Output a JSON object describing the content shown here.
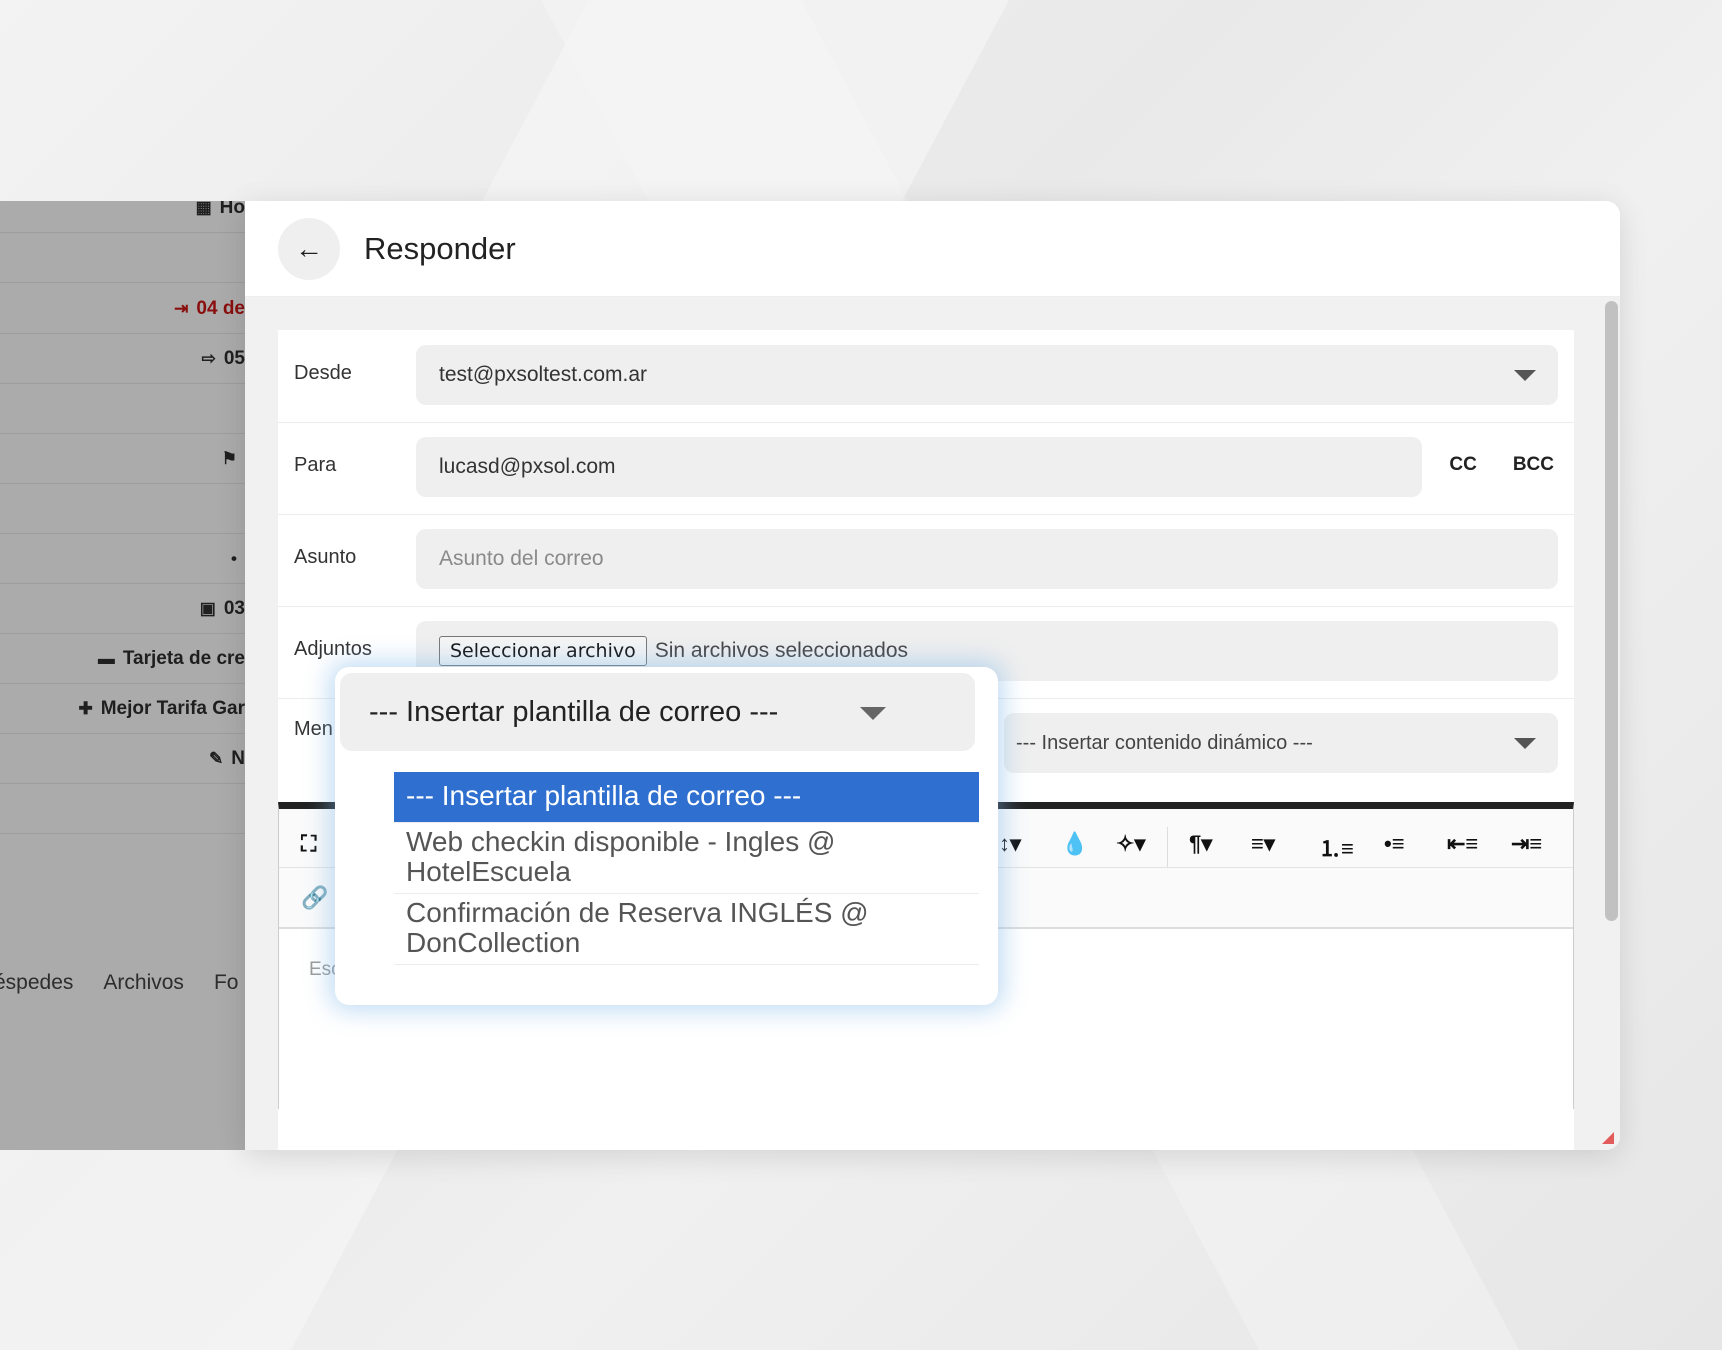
{
  "left_panel": {
    "rows": [
      {
        "icon": "building-icon",
        "glyph": "▦",
        "text": "Ho"
      },
      {
        "icon": "",
        "glyph": "",
        "text": ""
      },
      {
        "icon": "checkin-icon",
        "glyph": "⇥",
        "text": "04 de"
      },
      {
        "icon": "checkout-icon",
        "glyph": "⇨",
        "text": "05"
      },
      {
        "icon": "",
        "glyph": "",
        "text": ""
      },
      {
        "icon": "flag-icon",
        "glyph": "⚑",
        "text": ""
      },
      {
        "icon": "",
        "glyph": "",
        "text": ""
      },
      {
        "icon": "dot-icon",
        "glyph": "•",
        "text": ""
      },
      {
        "icon": "calendar-icon",
        "glyph": "▣",
        "text": "03"
      },
      {
        "icon": "credit-card-icon",
        "glyph": "▬",
        "text": "Tarjeta de cre"
      },
      {
        "icon": "tags-icon",
        "glyph": "✚",
        "text": "Mejor Tarifa Gar"
      },
      {
        "icon": "document-edit-icon",
        "glyph": "✎",
        "text": "N"
      }
    ],
    "tabs": [
      "éspedes",
      "Archivos",
      "Fo"
    ]
  },
  "modal": {
    "title": "Responder",
    "desde_label": "Desde",
    "desde_value": "test@pxsoltest.com.ar",
    "para_label": "Para",
    "para_value": "lucasd@pxsol.com",
    "cc_label": "CC",
    "bcc_label": "BCC",
    "asunto_label": "Asunto",
    "asunto_placeholder": "Asunto del correo",
    "adjuntos_label": "Adjuntos",
    "file_button": "Seleccionar archivo",
    "file_status": "Sin archivos seleccionados",
    "mensaje_label": "Men",
    "dynamic_placeholder": "--- Insertar contenido dinámico ---",
    "editor_placeholder": "Esc"
  },
  "template_dropdown": {
    "selected": "--- Insertar plantilla de correo ---",
    "options": [
      "--- Insertar plantilla de correo ---",
      "Web checkin disponible - Ingles @ HotelEscuela",
      "Confirmación de Reserva INGLÉS @ DonCollection"
    ]
  },
  "toolbar": {
    "icons": [
      "fullscreen-icon",
      "line-height-icon",
      "color-icon",
      "magic-icon",
      "paragraph-icon",
      "align-icon",
      "ordered-list-icon",
      "unordered-list-icon",
      "outdent-icon",
      "indent-icon",
      "link-icon"
    ]
  },
  "colors": {
    "accent": "#2f6fd0",
    "checkin_red": "#8a0e0e"
  }
}
